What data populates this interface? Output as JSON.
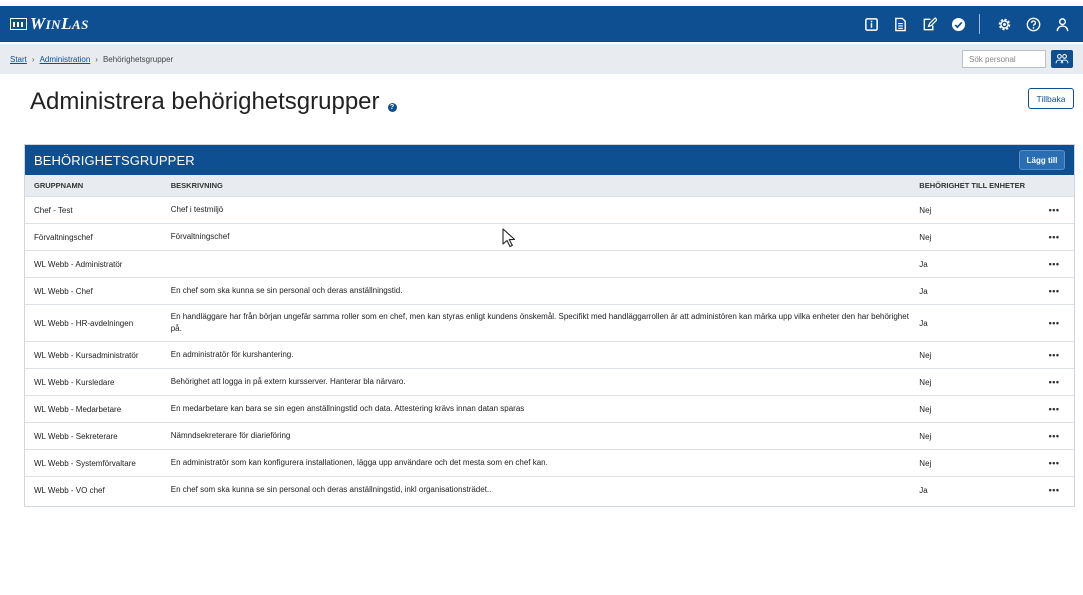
{
  "app": {
    "logo_text": "WinLas"
  },
  "topbar": {
    "icons": [
      "info-icon",
      "document-icon",
      "edit-icon",
      "check-circle-icon",
      "settings-icon",
      "help-icon",
      "user-icon"
    ]
  },
  "breadcrumb": {
    "items": [
      "Start",
      "Administration"
    ],
    "current": "Behörighetsgrupper",
    "separator": "›"
  },
  "search": {
    "placeholder": "Sök personal"
  },
  "page": {
    "title": "Administrera behörighetsgrupper",
    "help_label": "?",
    "back_label": "Tillbaka"
  },
  "panel": {
    "title": "BEHÖRIGHETSGRUPPER",
    "add_label": "Lägg till",
    "columns": [
      "GRUPPNAMN",
      "BESKRIVNING",
      "BEHÖRIGHET TILL ENHETER"
    ],
    "rows": [
      {
        "name": "Chef - Test",
        "description": "Chef i testmiljö",
        "units": "Nej"
      },
      {
        "name": "Förvaltningschef",
        "description": "Förvaltningschef",
        "units": "Nej"
      },
      {
        "name": "WL Webb - Administratör",
        "description": "",
        "units": "Ja"
      },
      {
        "name": "WL Webb - Chef",
        "description": "En chef som ska kunna se sin personal och deras anställningstid.",
        "units": "Ja"
      },
      {
        "name": "WL Webb - HR-avdelningen",
        "description": "En handläggare har från början ungefär samma roller som en chef, men kan styras enligt kundens önskemål. Specifikt med handläggarrollen är att administören kan märka upp vilka enheter den har behörighet på.",
        "units": "Ja"
      },
      {
        "name": "WL Webb - Kursadministratör",
        "description": "En administratör för kurshantering.",
        "units": "Nej"
      },
      {
        "name": "WL Webb - Kursledare",
        "description": "Behörighet att logga in på extern kursserver. Hanterar bla närvaro.",
        "units": "Nej"
      },
      {
        "name": "WL Webb - Medarbetare",
        "description": "En medarbetare kan bara se sin egen anställningstid och data. Attestering krävs innan datan sparas",
        "units": "Nej"
      },
      {
        "name": "WL Webb - Sekreterare",
        "description": "Nämndsekreterare för diarieföring",
        "units": "Nej"
      },
      {
        "name": "WL Webb - Systemförvaltare",
        "description": "En administratör som kan konfigurera installationen, lägga upp användare och det mesta som en chef kan.",
        "units": "Nej"
      },
      {
        "name": "WL Webb - VO chef",
        "description": "En chef som ska kunna se sin personal och deras anställningstid, inkl organisationsträdet..",
        "units": "Ja"
      }
    ],
    "row_menu_label": "•••"
  },
  "colors": {
    "primary": "#0d4f91",
    "bar_bg": "#e8ecf0"
  }
}
